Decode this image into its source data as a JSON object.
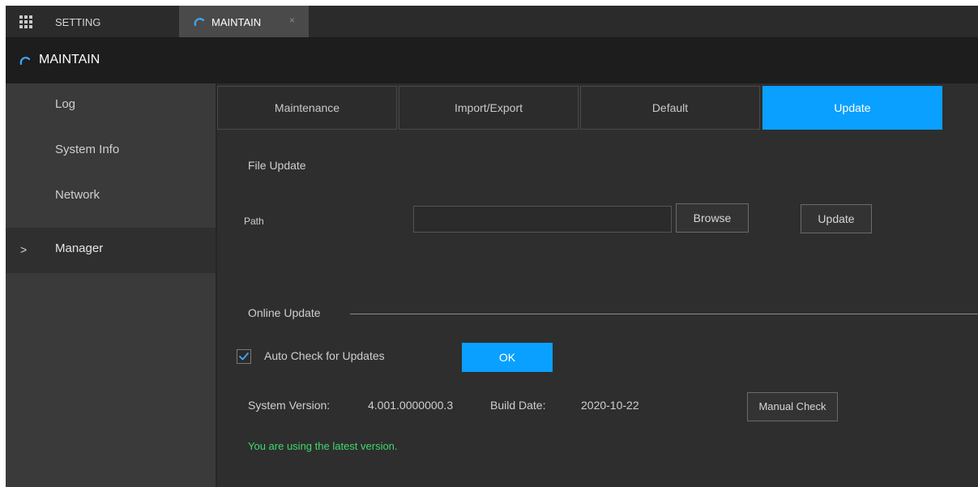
{
  "topbar": {
    "setting_label": "SETTING",
    "active_tab_label": "MAINTAIN",
    "close_glyph": "×"
  },
  "header": {
    "title": "MAINTAIN"
  },
  "sidebar": {
    "items": [
      {
        "label": "Log"
      },
      {
        "label": "System Info"
      },
      {
        "label": "Network"
      },
      {
        "label": "Manager",
        "active": true,
        "marker": ">"
      }
    ]
  },
  "tabs": [
    {
      "label": "Maintenance"
    },
    {
      "label": "Import/Export"
    },
    {
      "label": "Default"
    },
    {
      "label": "Update",
      "active": true
    }
  ],
  "file_update": {
    "title": "File Update",
    "path_label": "Path",
    "path_value": "",
    "browse_label": "Browse",
    "update_label": "Update"
  },
  "online_update": {
    "title": "Online Update",
    "auto_check_label": "Auto Check for Updates",
    "auto_check_checked": true,
    "ok_label": "OK",
    "system_version_label": "System Version:",
    "system_version_value": "4.001.0000000.3",
    "build_date_label": "Build Date:",
    "build_date_value": "2020-10-22",
    "manual_check_label": "Manual Check",
    "status_text": "You are using the latest version."
  },
  "colors": {
    "accent": "#0aa0ff",
    "success_text": "#3fd96b"
  },
  "icons": {
    "app_menu": "grid-icon",
    "maintain": "arc-icon",
    "check": "check-icon"
  }
}
